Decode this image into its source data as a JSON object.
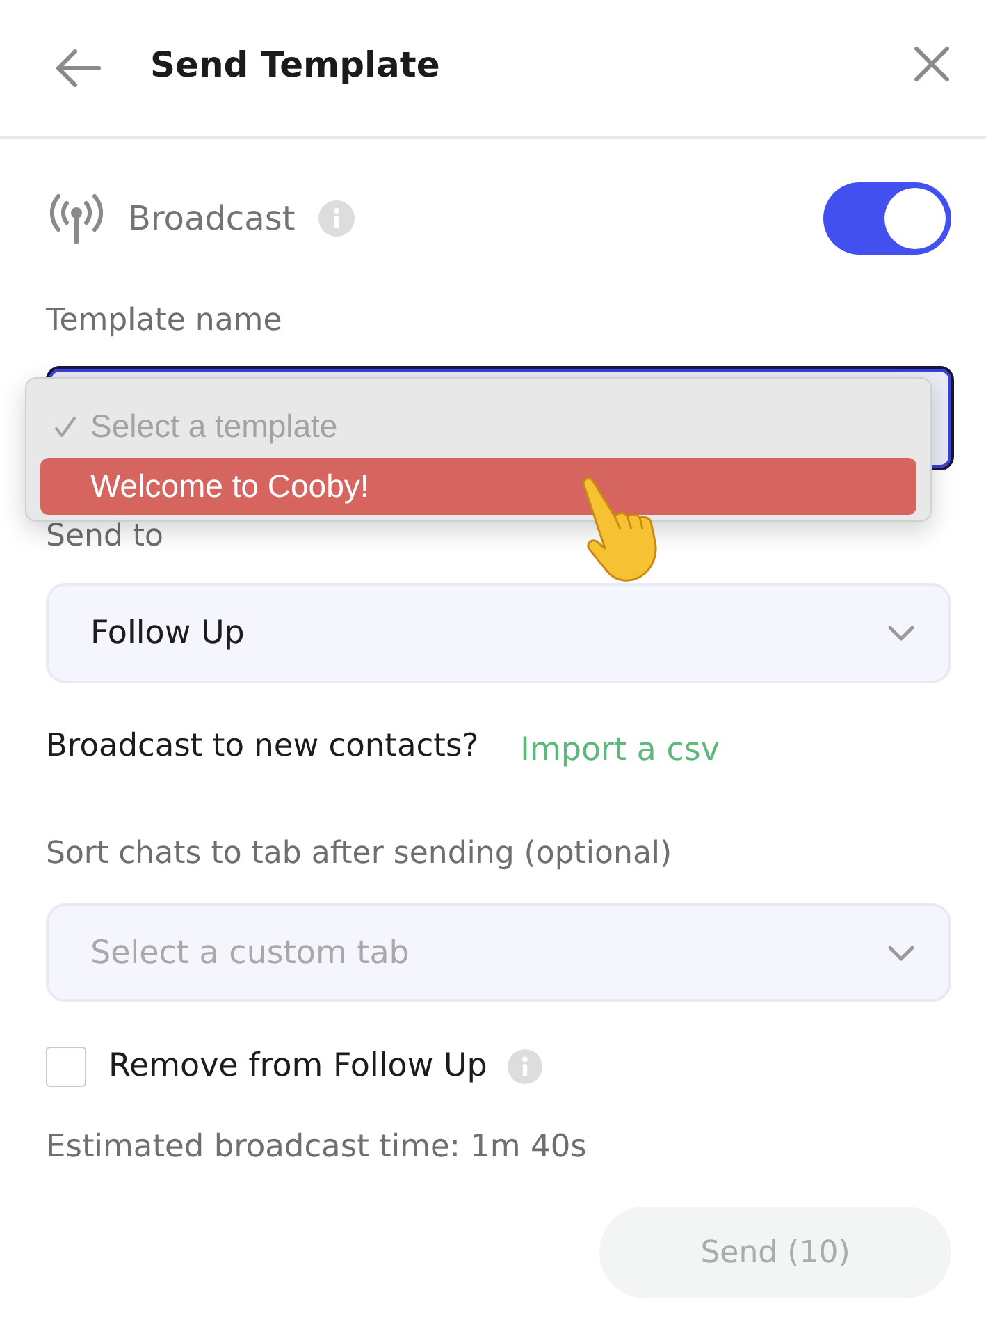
{
  "header": {
    "title": "Send Template"
  },
  "broadcast": {
    "label": "Broadcast",
    "on": true
  },
  "template": {
    "label": "Template name",
    "focused": true,
    "options": [
      {
        "label": "Select a template",
        "selected": true,
        "highlighted": false,
        "disabled": true
      },
      {
        "label": "Welcome to Cooby!",
        "selected": false,
        "highlighted": true,
        "disabled": false
      }
    ]
  },
  "send_to": {
    "label": "Send to",
    "value": "Follow Up"
  },
  "new_contacts": {
    "question": "Broadcast to new contacts?",
    "link": "Import a csv"
  },
  "sort_tab": {
    "label": "Sort chats to tab after sending (optional)",
    "placeholder": "Select a custom tab"
  },
  "remove_option": {
    "label": "Remove from Follow Up",
    "checked": false
  },
  "estimate": "Estimated broadcast time: 1m 40s",
  "send_button": {
    "label": "Send (10)",
    "disabled": true
  }
}
